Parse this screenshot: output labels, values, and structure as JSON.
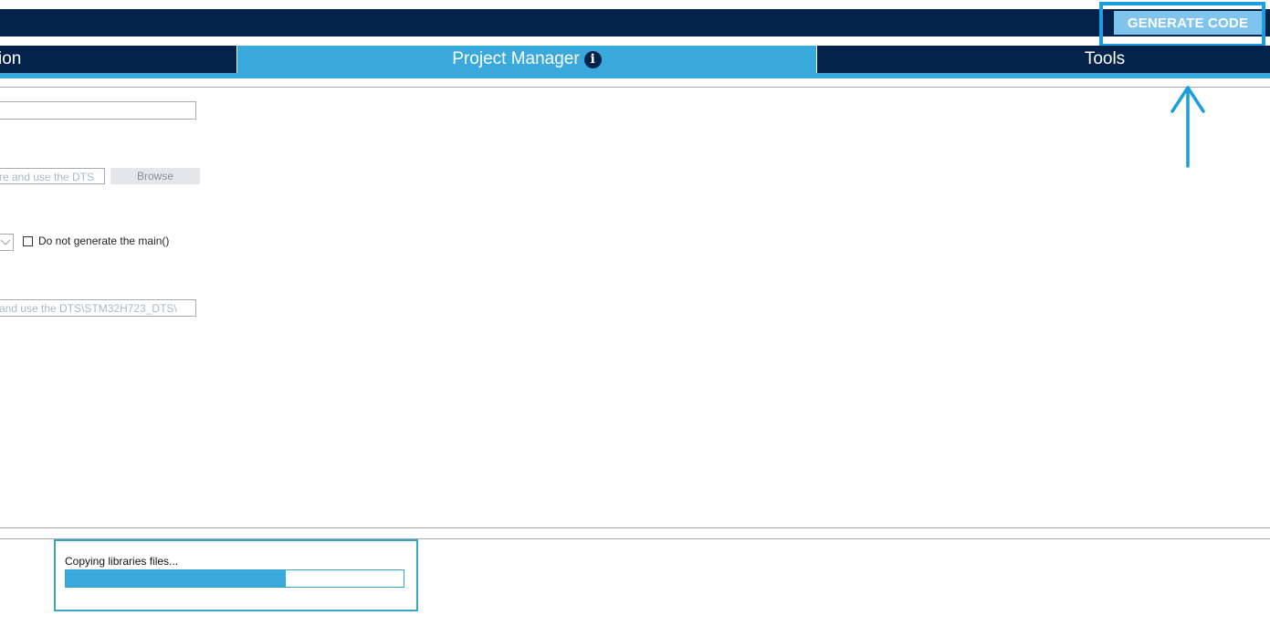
{
  "toolbar": {
    "generate_label": "GENERATE CODE"
  },
  "tabs": [
    {
      "label": "ion"
    },
    {
      "label": "Project Manager",
      "active": true
    },
    {
      "label": "Tools"
    }
  ],
  "form": {
    "field1_value": "",
    "field2_value": "re and use the DTS",
    "browse_label": "Browse",
    "checkbox_label": "Do not generate the main()",
    "field3_value": " and use the DTS\\STM32H723_DTS\\"
  },
  "progress": {
    "label": "Copying libraries files...",
    "fraction": 0.65
  },
  "colors": {
    "dark": "#03234b",
    "accent": "#39a9dc",
    "highlight": "#1a9ee0",
    "button": "#7ec4ec"
  }
}
